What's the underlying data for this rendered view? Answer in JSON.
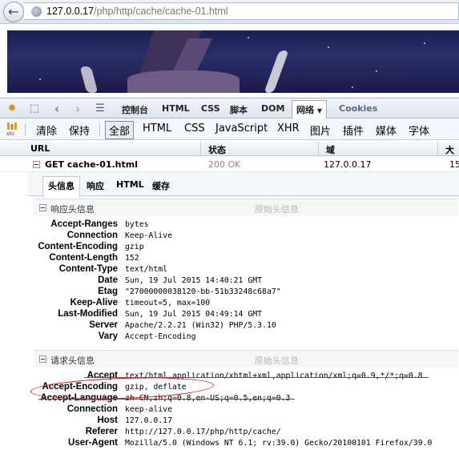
{
  "address_bar": {
    "url_host": "127.0.0.17",
    "url_path": "/php/http/cache/cache-01.html"
  },
  "firebug": {
    "panels": [
      "控制台",
      "HTML",
      "CSS",
      "脚本",
      "DOM",
      "网络",
      "Cookies"
    ],
    "active_panel": "网络",
    "filters": [
      "清除",
      "保持",
      "全部",
      "HTML",
      "CSS",
      "JavaScript",
      "XHR",
      "图片",
      "插件",
      "媒体",
      "字体"
    ],
    "active_filter": "全部",
    "columns": [
      "URL",
      "状态",
      "域",
      "大小"
    ],
    "request": {
      "url": "GET cache-01.html",
      "status": "200 OK",
      "domain": "127.0.0.17",
      "size": "15"
    },
    "detail_tabs": [
      "头信息",
      "响应",
      "HTML",
      "缓存"
    ],
    "active_detail_tab": "头信息",
    "response_section": {
      "title": "响应头信息",
      "raw_link": "原始头信息",
      "headers": [
        {
          "k": "Accept-Ranges",
          "v": "bytes"
        },
        {
          "k": "Connection",
          "v": "Keep-Alive"
        },
        {
          "k": "Content-Encoding",
          "v": "gzip"
        },
        {
          "k": "Content-Length",
          "v": "152"
        },
        {
          "k": "Content-Type",
          "v": "text/html"
        },
        {
          "k": "Date",
          "v": "Sun, 19 Jul 2015 14:40:21 GMT"
        },
        {
          "k": "Etag",
          "v": "\"27000000038120-bb-51b33248c68a7\""
        },
        {
          "k": "Keep-Alive",
          "v": "timeout=5, max=100"
        },
        {
          "k": "Last-Modified",
          "v": "Sun, 19 Jul 2015 04:49:14 GMT"
        },
        {
          "k": "Server",
          "v": "Apache/2.2.21 (Win32) PHP/5.3.10"
        },
        {
          "k": "Vary",
          "v": "Accept-Encoding"
        }
      ]
    },
    "request_section": {
      "title": "请求头信息",
      "raw_link": "原始头信息",
      "headers": [
        {
          "k": "Accept",
          "v": "text/html,application/xhtml+xml,application/xml;q=0.9,*/*;q=0.8"
        },
        {
          "k": "Accept-Encoding",
          "v": "gzip, deflate"
        },
        {
          "k": "Accept-Language",
          "v": "zh-CN,zh;q=0.8,en-US;q=0.5,en;q=0.3"
        },
        {
          "k": "Connection",
          "v": "keep-alive"
        },
        {
          "k": "Host",
          "v": "127.0.0.17"
        },
        {
          "k": "Referer",
          "v": "http://127.0.0.17/php/http/cache/"
        },
        {
          "k": "User-Agent",
          "v": "Mozilla/5.0 (Windows NT 6.1; rv:39.0) Gecko/20100101 Firefox/39.0"
        }
      ]
    }
  },
  "colors": {
    "annotation": "#dd1111",
    "firebug_blue": "#2c5fa8"
  }
}
